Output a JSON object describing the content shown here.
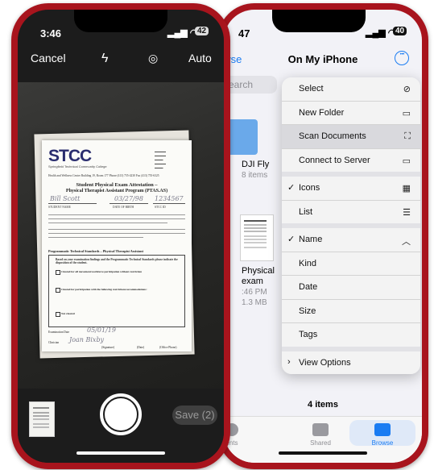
{
  "left_phone": {
    "time": "3:46",
    "battery": "42",
    "cancel_label": "Cancel",
    "flash_icon": "flash-icon",
    "filter_icon": "filter-icon",
    "auto_label": "Auto",
    "save_label": "Save (2)",
    "document": {
      "logo": "STCC",
      "logo_sub": "Springfield Technical Community College",
      "address": "Health and Wellness Center  Building 19, Room 177  Phone (413) 755-4230  Fax (413) 755-6325",
      "title1": "Student Physical Exam Attestation –",
      "title2": "Physical Therapist Assistant Program (PTAS.AS)",
      "name_hand": "Bill Scott",
      "date_hand": "03/27/98",
      "id_hand": "1234567",
      "student_name_label": "STUDENT NAME",
      "dob_label": "DATE OF BIRTH",
      "stcc_id_label": "STCC ID",
      "standards_heading": "Programmatic Technical Standards – Physical Therapist Assistant",
      "box_heading": "Based on your examination findings and the Programmatic Technical Standards please indicate the disposition of the student.",
      "option1": "Cleared for all movement/workforce participation without restriction",
      "option2": "Cleared for participation with the following restrictions/accommodations:",
      "option3": "Not cleared",
      "exam_date_label": "Examination Date",
      "exam_date_hand": "05/01/19",
      "clinician_label": "Clinician",
      "clinician_hand": "Joan Bixby",
      "signature_label": "(Signature)",
      "date_label": "(Date)",
      "office_label": "(Office Phone)"
    }
  },
  "right_phone": {
    "time": "47",
    "battery": "40",
    "back_label": "owse",
    "title": "On My iPhone",
    "search_placeholder": "earch",
    "folder_name": "DJI Fly",
    "folder_meta": "8 items",
    "file_name_1": "Physical",
    "file_name_2": "exam",
    "file_meta_1": ":46 PM",
    "file_meta_2": "1.3 MB",
    "items_count": "4 items",
    "tabs": [
      {
        "label": "ents",
        "icon": "clock-icon"
      },
      {
        "label": "Shared",
        "icon": "shared-folder-icon"
      },
      {
        "label": "Browse",
        "icon": "folder-icon"
      }
    ],
    "menu": {
      "select": "Select",
      "new_folder": "New Folder",
      "scan_documents": "Scan Documents",
      "connect_to_server": "Connect to Server",
      "icons": "Icons",
      "list": "List",
      "name": "Name",
      "kind": "Kind",
      "date": "Date",
      "size": "Size",
      "tags": "Tags",
      "view_options": "View Options"
    }
  },
  "colors": {
    "phone_frame": "#a8141d",
    "accent": "#1a7cf2"
  }
}
